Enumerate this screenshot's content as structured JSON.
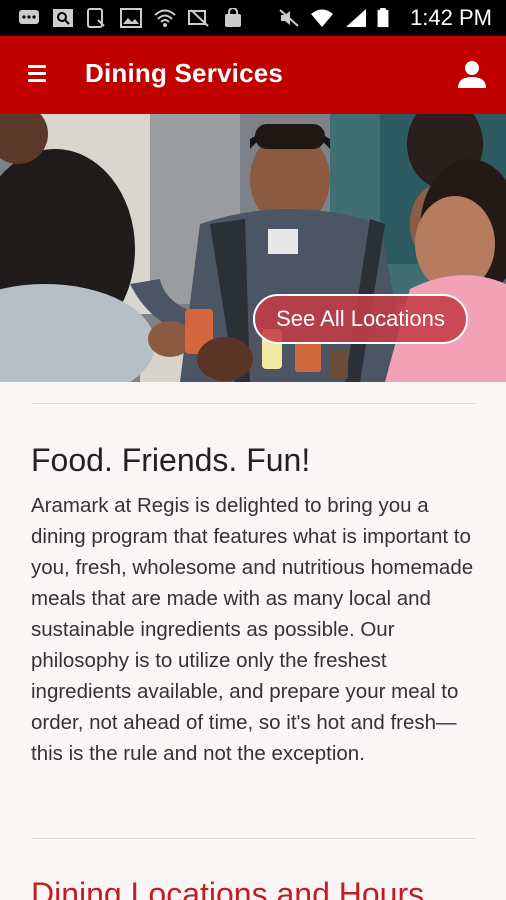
{
  "status_bar": {
    "time": "1:42 PM",
    "icons": [
      "message-icon",
      "search-icon",
      "tablet-icon",
      "image-icon",
      "wifi-icon",
      "data-off-icon",
      "bag-icon",
      "mute-icon",
      "wifi-signal-icon",
      "cell-signal-icon",
      "battery-icon"
    ]
  },
  "app_bar": {
    "title": "Dining Services",
    "menu_icon": "hamburger-menu-icon",
    "account_icon": "account-icon",
    "color": "#c00000"
  },
  "hero": {
    "button_label": "See All Locations"
  },
  "intro": {
    "heading": "Food. Friends. Fun!",
    "body": "Aramark at Regis is delighted to bring you a dining program that features what is important to you, fresh, wholesome and nutritious homemade meals that are made with as many local and sustainable ingredients as possible. Our philosophy is to utilize only the freshest ingredients available, and prepare your meal to order, not ahead of time, so it's hot and fresh—this is the rule and not the exception."
  },
  "next_section": {
    "heading": "Dining Locations and Hours",
    "color": "#c21c24"
  }
}
